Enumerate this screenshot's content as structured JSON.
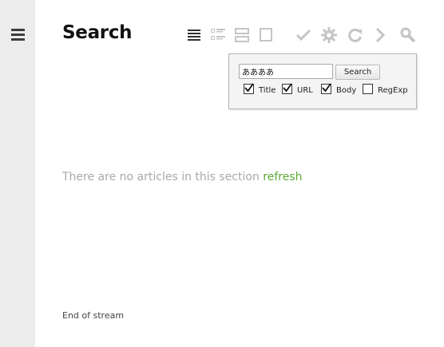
{
  "page": {
    "title": "Search"
  },
  "sidebar": {
    "menu_icon": "hamburger-menu-icon"
  },
  "toolbar": {
    "view_icons": [
      "list-view-icon",
      "detailed-list-view-icon",
      "expanded-view-icon",
      "full-article-view-icon"
    ],
    "action_icons": [
      "mark-read-icon",
      "settings-gear-icon",
      "refresh-icon",
      "next-arrow-icon",
      "search-magnifier-icon"
    ]
  },
  "search_popup": {
    "query": "ああああ",
    "button_label": "Search",
    "options": [
      {
        "label": "Title",
        "checked": true
      },
      {
        "label": "URL",
        "checked": true
      },
      {
        "label": "Body",
        "checked": true
      },
      {
        "label": "RegExp",
        "checked": false
      }
    ]
  },
  "content": {
    "empty_message": "There are no articles in this section",
    "refresh_link": "refresh",
    "end_of_stream": "End of stream"
  },
  "colors": {
    "sidebar_bg": "#ececec",
    "active_icon": "#3c3c3c",
    "inactive_icon": "#c4c4c4",
    "link": "#5aa832",
    "muted_text": "#a8a8a8"
  }
}
